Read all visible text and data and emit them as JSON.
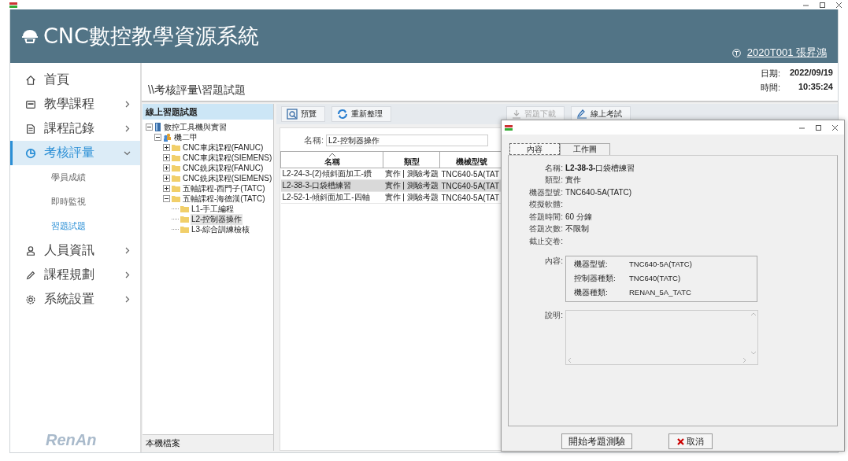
{
  "app": {
    "title": "CNC數控教學資源系統",
    "user": "2020T001 張昇鴻",
    "logo_text": "RenAn"
  },
  "sidebar": {
    "items": [
      {
        "label": "首頁",
        "selected": false
      },
      {
        "label": "教學課程",
        "selected": false,
        "expanded": false
      },
      {
        "label": "課程記錄",
        "selected": false,
        "expanded": false
      },
      {
        "label": "考核評量",
        "selected": true,
        "expanded": true,
        "children": [
          {
            "label": "學員成績",
            "selected": false
          },
          {
            "label": "即時監視",
            "selected": false
          },
          {
            "label": "習題試題",
            "selected": true
          }
        ]
      },
      {
        "label": "人員資訊",
        "selected": false,
        "expanded": false
      },
      {
        "label": "課程規劃",
        "selected": false,
        "expanded": false
      },
      {
        "label": "系統設置",
        "selected": false,
        "expanded": false
      }
    ]
  },
  "breadcrumb": "\\\\考核評量\\習題試題",
  "datetime": {
    "date_label": "日期:",
    "date": "2022/09/19",
    "time_label": "時間:",
    "time": "10:35:24"
  },
  "tree_panel": {
    "title": "線上習題試題",
    "footer": "本機檔案",
    "nodes": [
      {
        "label": "數控工具機與實習",
        "kind": "book",
        "expanded": true,
        "children": [
          {
            "label": "機二甲",
            "kind": "group",
            "expanded": true,
            "children": [
              {
                "label": "CNC車床課程(FANUC)",
                "kind": "folder",
                "expanded": false
              },
              {
                "label": "CNC車床課程(SIEMENS)",
                "kind": "folder",
                "expanded": false
              },
              {
                "label": "CNC銑床課程(FANUC)",
                "kind": "folder",
                "expanded": false
              },
              {
                "label": "CNC銑床課程(SIEMENS)",
                "kind": "folder",
                "expanded": false
              },
              {
                "label": "五軸課程-西門子(TATC)",
                "kind": "folder",
                "expanded": false
              },
              {
                "label": "五軸課程-海德漢(TATC)",
                "kind": "folder",
                "expanded": true,
                "children": [
                  {
                    "label": "L1-手工編程",
                    "kind": "folder",
                    "selected": false
                  },
                  {
                    "label": "L2-控制器操作",
                    "kind": "folder",
                    "selected": true
                  },
                  {
                    "label": "L3-綜合訓練檢核",
                    "kind": "folder",
                    "selected": false
                  }
                ]
              }
            ]
          }
        ]
      }
    ]
  },
  "toolbar": [
    {
      "label": "預覽",
      "kind": "preview",
      "disabled": false
    },
    {
      "label": "重新整理",
      "kind": "refresh",
      "disabled": false
    },
    {
      "label": "習題下載",
      "kind": "download",
      "disabled": true
    },
    {
      "label": "線上考試",
      "kind": "pen",
      "disabled": false
    }
  ],
  "filter": {
    "label": "名稱:",
    "value": "L2-控制器操作"
  },
  "table": {
    "columns": [
      "名稱",
      "類型",
      "機械型號"
    ],
    "rows": [
      {
        "cells": [
          "L2-24-3-(2)傾斜面加工-鑽",
          "實作 | 測驗考題",
          "TNC640-5A(TAT"
        ],
        "selected": false
      },
      {
        "cells": [
          "L2-38-3-口袋槽練習",
          "實作 | 測驗考題",
          "TNC640-5A(TAT"
        ],
        "selected": true
      },
      {
        "cells": [
          "L2-52-1-傾斜面加工-四軸",
          "實作 | 測驗考題",
          "TNC640-5A(TAT"
        ],
        "selected": false
      }
    ]
  },
  "dialog": {
    "tabs": [
      {
        "label": "內容",
        "selected": true
      },
      {
        "label": "工作圖",
        "selected": false
      }
    ],
    "fields": [
      {
        "label": "名稱:",
        "value": "**L2-38-3-**口袋槽練習"
      },
      {
        "label": "類型:",
        "value": "實作"
      },
      {
        "label": "機器型號:",
        "value": "TNC640-5A(TATC)"
      },
      {
        "label": "模擬軟體:"
      },
      {
        "label": "答題時間:",
        "value": "60 分鐘"
      },
      {
        "label": "答題次數:",
        "value": "不限制"
      },
      {
        "label": "截止交卷:"
      }
    ],
    "content_label": "內容:",
    "content_rows": [
      {
        "label": "機器型號:",
        "value": "TNC640-5A(TATC)"
      },
      {
        "label": "控制器種類:",
        "value": "TNC640(TATC)"
      },
      {
        "label": "機器種類:",
        "value": "RENAN_5A_TATC"
      }
    ],
    "note_label": "說明:",
    "buttons": [
      {
        "label": "開始考題測驗",
        "kind": "primary"
      },
      {
        "label": "取消",
        "kind": "cancel"
      }
    ]
  }
}
